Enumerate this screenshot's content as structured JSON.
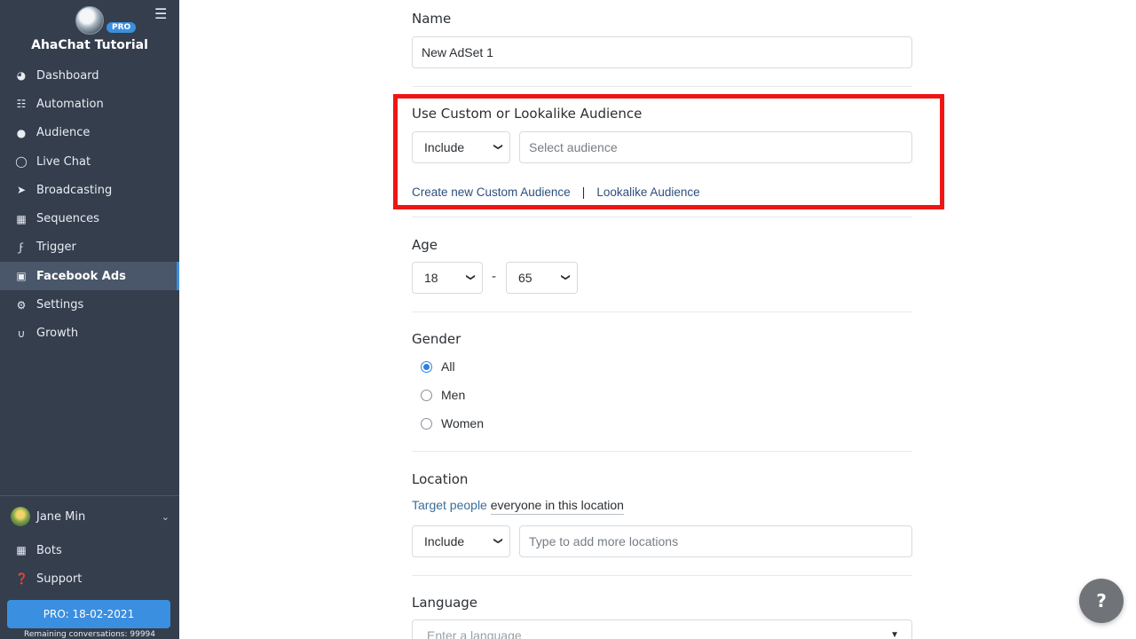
{
  "sidebar": {
    "brand": {
      "name": "AhaChat Tutorial",
      "badge": "PRO"
    },
    "items": [
      {
        "label": "Dashboard",
        "icon": "dashboard-icon"
      },
      {
        "label": "Automation",
        "icon": "sitemap-icon"
      },
      {
        "label": "Audience",
        "icon": "user-icon"
      },
      {
        "label": "Live Chat",
        "icon": "chat-icon"
      },
      {
        "label": "Broadcasting",
        "icon": "paper-plane-icon"
      },
      {
        "label": "Sequences",
        "icon": "calendar-icon"
      },
      {
        "label": "Trigger",
        "icon": "bolt-icon"
      },
      {
        "label": "Facebook Ads",
        "icon": "facebook-icon",
        "active": true
      },
      {
        "label": "Settings",
        "icon": "gear-icon"
      },
      {
        "label": "Growth",
        "icon": "magnet-icon"
      }
    ],
    "user": {
      "name": "Jane Min"
    },
    "bottom_items": [
      {
        "label": "Bots",
        "icon": "grid-icon"
      },
      {
        "label": "Support",
        "icon": "question-circle-icon"
      }
    ],
    "pro_button": "PRO: 18-02-2021",
    "remaining": "Remaining conversations: 99994"
  },
  "form": {
    "name": {
      "label": "Name",
      "value": "New AdSet 1"
    },
    "audience": {
      "label": "Use Custom or Lookalike Audience",
      "mode": "Include",
      "placeholder": "Select audience",
      "create_link": "Create new Custom Audience",
      "separator": "|",
      "lookalike_link": "Lookalike Audience"
    },
    "age": {
      "label": "Age",
      "min": "18",
      "separator": "-",
      "max": "65"
    },
    "gender": {
      "label": "Gender",
      "options": [
        {
          "label": "All",
          "checked": true
        },
        {
          "label": "Men",
          "checked": false
        },
        {
          "label": "Women",
          "checked": false
        }
      ]
    },
    "location": {
      "label": "Location",
      "target_prefix": "Target people",
      "target_value": "everyone in this location",
      "mode": "Include",
      "placeholder": "Type to add more locations"
    },
    "language": {
      "label": "Language",
      "placeholder": "Enter a language"
    }
  },
  "help_button": "?",
  "colors": {
    "sidebar_bg": "#343e4d",
    "accent": "#3b8fe0",
    "highlight": "#f01515",
    "link": "#2d4f7d"
  }
}
